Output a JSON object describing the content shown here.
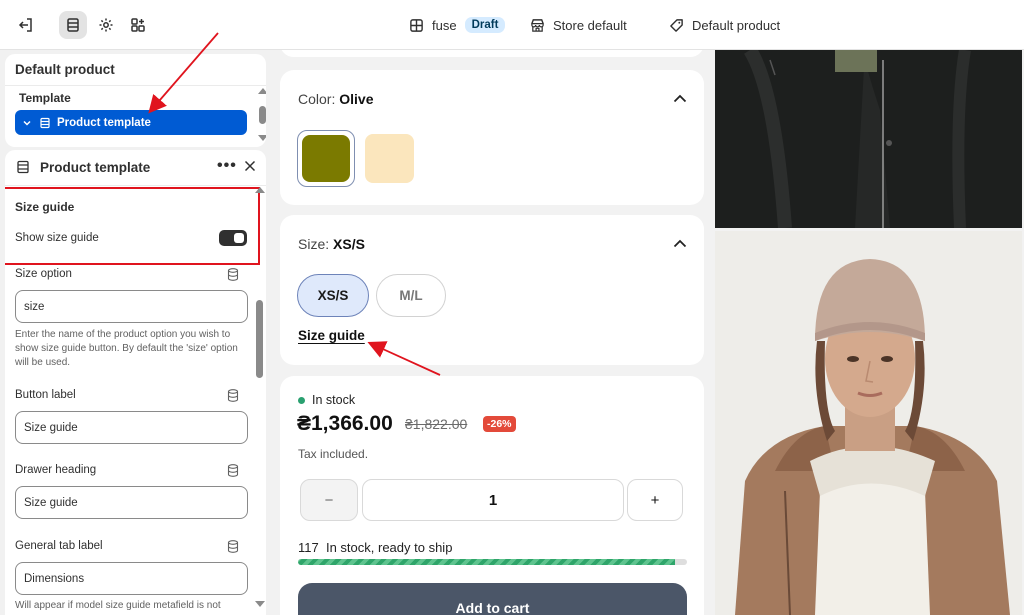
{
  "topbar": {
    "exit_icon": "exit-icon",
    "sections_icon": "sections-icon",
    "settings_icon": "gear-icon",
    "apps_icon": "apps-icon",
    "theme_name": "fuse",
    "theme_status": "Draft",
    "store_label": "Store default",
    "product_label": "Default product"
  },
  "sidebar_top": {
    "title": "Default product",
    "template_label": "Template",
    "selected_template": "Product template"
  },
  "sidebar": {
    "header_title": "Product template",
    "more_icon": "more-icon",
    "size_guide": {
      "heading": "Size guide",
      "show_label": "Show size guide",
      "show_enabled": true
    },
    "fields": [
      {
        "label": "Size option",
        "value": "size",
        "help": "Enter the name of the product option you wish to show size guide button. By default the 'size' option will be used."
      },
      {
        "label": "Button label",
        "value": "Size guide"
      },
      {
        "label": "Drawer heading",
        "value": "Size guide"
      },
      {
        "label": "General tab label",
        "value": "Dimensions",
        "help": "Will appear if model size guide metafield is not"
      }
    ]
  },
  "preview": {
    "color": {
      "label": "Color:",
      "value": "Olive",
      "swatches": [
        "#7b7a00",
        "#fbe6bd"
      ]
    },
    "size": {
      "label": "Size:",
      "value": "XS/S",
      "options": [
        "XS/S",
        "M/L"
      ],
      "guide_link": "Size guide"
    },
    "stock": {
      "status": "In stock"
    },
    "price": {
      "current": "₴1,366.00",
      "original": "₴1,822.00",
      "discount": "-26%"
    },
    "tax_note": "Tax included.",
    "quantity": {
      "minus": "−",
      "value": "1",
      "plus": "+"
    },
    "inventory": {
      "count": "117",
      "text": "In stock, ready to ship",
      "level": 0.97
    },
    "add_to_cart": "Add to cart",
    "colors": {
      "accent": "#005bd3",
      "stock_green": "#2aa070",
      "discount_red": "#e34a3a",
      "highlight_red": "#e0141e"
    }
  }
}
